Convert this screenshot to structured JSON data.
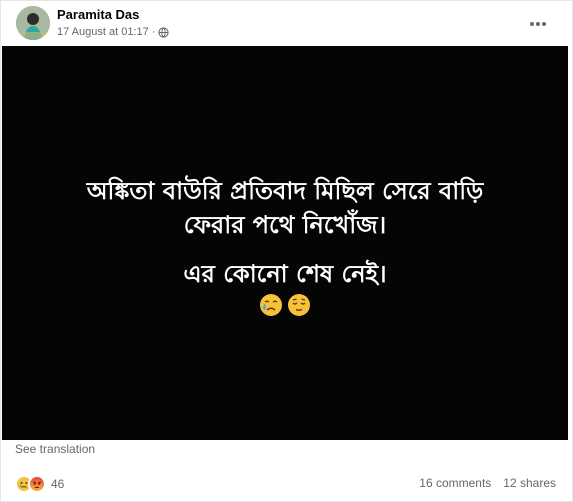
{
  "post": {
    "author": "Paramita Das",
    "timestamp": "17 August at 01:17",
    "separator": "·",
    "privacy_icon": "globe-icon",
    "more_icon": "ellipsis-icon"
  },
  "image_text": {
    "line1": "অঙ্কিতা বাউরি প্রতিবাদ মিছিল সেরে বাড়ি",
    "line2": "ফেরার পথে নিখোঁজ।",
    "line3": "এর কোনো শেষ নেই।",
    "emojis": [
      "crying-face-icon",
      "relieved-face-icon"
    ]
  },
  "see_translation": "See translation",
  "reactions": {
    "icons": [
      "sad-reaction-icon",
      "angry-reaction-icon"
    ],
    "count": "46"
  },
  "stats": {
    "comments": "16 comments",
    "shares": "12 shares"
  },
  "colors": {
    "secondary_text": "#65676b",
    "image_background": "#050505"
  }
}
